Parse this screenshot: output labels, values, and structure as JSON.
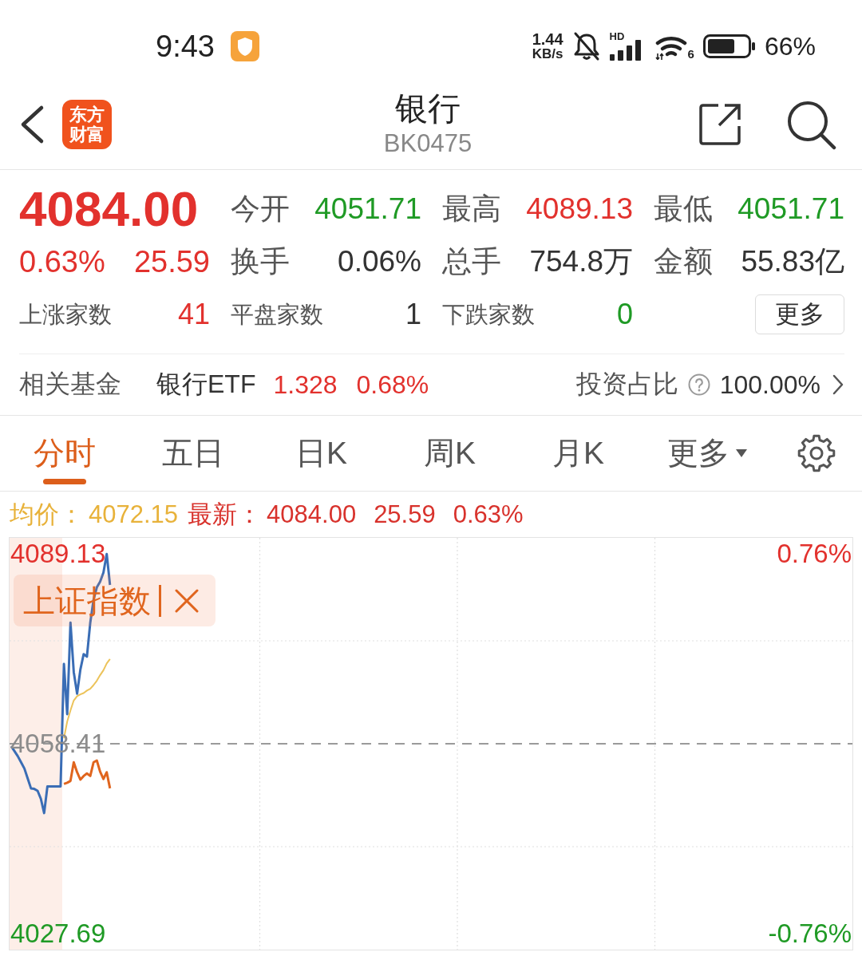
{
  "status_bar": {
    "time": "9:43",
    "net_speed": {
      "value": "1.44",
      "unit": "KB/s"
    },
    "signal_label": "HD",
    "wifi_label": "6",
    "battery": "66%"
  },
  "header": {
    "logo": [
      "东方",
      "财富"
    ],
    "title": "银行",
    "code": "BK0475"
  },
  "quote": {
    "price": {
      "text": "4084.00",
      "color": "#e2312d"
    },
    "change_pct": {
      "text": "0.63%",
      "color": "#e2312d"
    },
    "change": {
      "text": "25.59",
      "color": "#e2312d"
    },
    "stats": [
      {
        "label": "今开",
        "value": "4051.71",
        "color": "#1f9a25"
      },
      {
        "label": "最高",
        "value": "4089.13",
        "color": "#e2312d"
      },
      {
        "label": "最低",
        "value": "4051.71",
        "color": "#1f9a25"
      },
      {
        "label": "换手",
        "value": "0.06%",
        "color": "#333333"
      },
      {
        "label": "总手",
        "value": "754.8万",
        "color": "#333333"
      },
      {
        "label": "金额",
        "value": "55.83亿",
        "color": "#333333"
      }
    ],
    "breadth": [
      {
        "label": "上涨家数",
        "value": "41",
        "color": "#e2312d"
      },
      {
        "label": "平盘家数",
        "value": "1",
        "color": "#333333"
      },
      {
        "label": "下跌家数",
        "value": "0",
        "color": "#1f9a25"
      }
    ],
    "more_button": "更多"
  },
  "related_fund": {
    "label": "相关基金",
    "name": "银行ETF",
    "price": "1.328",
    "change_pct": "0.68%",
    "color": "#e2312d",
    "weight_label": "投资占比",
    "weight": "100.00%"
  },
  "tabs": [
    {
      "label": "分时",
      "selected": true,
      "kind": "tab"
    },
    {
      "label": "五日",
      "selected": false,
      "kind": "tab"
    },
    {
      "label": "日K",
      "selected": false,
      "kind": "tab"
    },
    {
      "label": "周K",
      "selected": false,
      "kind": "tab"
    },
    {
      "label": "月K",
      "selected": false,
      "kind": "tab"
    },
    {
      "label": "更多",
      "selected": false,
      "kind": "menu"
    }
  ],
  "legend": [
    {
      "label": "均价：",
      "values": [
        "4072.15"
      ],
      "color": "#e8b23a"
    },
    {
      "label": "最新：",
      "values": [
        "4084.00",
        "25.59",
        "0.63%"
      ],
      "color": "#d8322c"
    }
  ],
  "chart": {
    "right_labels": [
      {
        "text": "0.76%",
        "color": "#e2312d"
      },
      {
        "text": "-0.76%",
        "color": "#1f9a25"
      }
    ],
    "chart_data": {
      "type": "line",
      "categories": [
        null,
        null,
        null,
        null,
        null,
        null,
        null,
        null,
        null,
        null,
        null,
        null,
        null,
        null,
        null,
        null,
        null,
        null,
        null,
        null,
        null,
        null,
        null,
        null,
        null,
        null,
        null,
        null,
        null,
        null,
        null,
        null,
        null,
        null,
        null,
        null,
        null,
        null,
        null,
        null,
        null,
        null,
        null,
        null,
        null,
        null,
        null,
        null,
        null,
        null,
        null,
        null,
        null,
        null,
        null,
        null,
        null,
        null,
        null,
        null,
        null,
        null,
        null,
        null,
        null,
        null,
        null,
        null,
        null,
        null,
        null,
        null,
        null,
        null,
        null,
        null,
        null,
        null,
        null,
        null,
        null,
        null,
        null,
        null,
        null,
        null,
        null,
        null,
        null,
        null,
        null,
        null,
        null,
        null,
        null,
        null,
        null,
        null,
        null,
        null,
        null,
        null,
        null,
        null,
        null,
        null,
        null,
        null,
        null,
        null,
        null,
        null,
        null,
        null,
        null,
        null,
        null,
        null,
        null,
        null,
        null,
        null,
        null,
        null,
        null,
        null,
        null,
        null,
        null,
        null,
        null,
        null,
        null,
        null,
        null,
        null,
        null,
        null,
        null,
        null,
        null,
        null,
        null,
        null,
        null,
        null,
        null,
        null,
        null,
        null,
        null,
        null,
        null,
        null,
        null,
        null,
        null,
        null,
        null,
        null,
        null,
        null,
        null,
        null,
        null,
        null,
        null,
        null,
        null,
        null,
        null,
        null,
        null,
        null,
        null,
        null,
        null,
        null,
        null,
        null,
        null,
        null,
        null,
        null,
        null,
        null,
        null,
        null,
        null,
        null,
        null,
        null,
        null,
        null,
        null,
        null,
        null,
        null,
        null,
        null,
        null,
        null,
        null,
        null,
        null,
        null,
        null,
        null,
        null,
        null,
        null,
        null,
        null,
        null,
        null,
        null,
        null,
        null,
        null,
        null,
        null,
        null,
        null,
        null,
        null,
        null,
        null,
        null,
        null,
        null,
        null,
        null,
        null,
        null,
        null,
        null,
        null,
        null,
        null,
        null,
        null,
        null,
        null,
        null,
        null,
        null,
        null,
        null,
        null,
        null,
        null,
        null,
        null,
        null,
        null,
        null
      ],
      "ylim": [
        4025.11,
        4091.71
      ],
      "yticks": [
        {
          "value": 4089.13,
          "label": "4089.13"
        },
        {
          "value": 4027.69,
          "label": "4027.69"
        }
      ],
      "ref_lines": [
        {
          "axis": "y",
          "value": 4058.41,
          "label": "4058.41"
        }
      ],
      "series": [
        {
          "color": "#3a6db5",
          "values": [
            4058.0,
            4057.2,
            4056.4,
            4055.4,
            4054.4,
            4052.8,
            4051.2,
            4051.1,
            4050.8,
            4049.5,
            4047.2,
            4051.5,
            4051.5,
            4051.5,
            4051.5,
            4051.5,
            4071.3,
            4063.2,
            4078.0,
            4070.0,
            4066.5,
            4070.4,
            4072.9,
            4072.5,
            4078.0,
            4081.7,
            4083.7,
            4084.6,
            4086.1,
            4089.1,
            4084.1,
            null,
            null,
            null,
            null,
            null,
            null,
            null,
            null,
            null,
            null,
            null,
            null,
            null,
            null,
            null,
            null,
            null,
            null,
            null,
            null,
            null,
            null,
            null,
            null,
            null,
            null,
            null,
            null,
            null,
            null,
            null,
            null,
            null,
            null,
            null,
            null,
            null,
            null,
            null,
            null,
            null,
            null,
            null,
            null,
            null,
            null,
            null,
            null,
            null,
            null,
            null,
            null,
            null,
            null,
            null,
            null,
            null,
            null,
            null,
            null,
            null,
            null,
            null,
            null,
            null,
            null,
            null,
            null,
            null,
            null,
            null,
            null,
            null,
            null,
            null,
            null,
            null,
            null,
            null,
            null,
            null,
            null,
            null,
            null,
            null,
            null,
            null,
            null,
            null,
            null,
            null,
            null,
            null,
            null,
            null,
            null,
            null,
            null,
            null,
            null,
            null,
            null,
            null,
            null,
            null,
            null,
            null,
            null,
            null,
            null,
            null,
            null,
            null,
            null,
            null,
            null,
            null,
            null,
            null,
            null,
            null,
            null,
            null,
            null,
            null,
            null,
            null,
            null,
            null,
            null,
            null,
            null,
            null,
            null,
            null,
            null,
            null,
            null,
            null,
            null,
            null,
            null,
            null,
            null,
            null,
            null,
            null,
            null,
            null,
            null,
            null,
            null,
            null,
            null,
            null,
            null,
            null,
            null,
            null,
            null,
            null,
            null,
            null,
            null,
            null,
            null,
            null,
            null,
            null,
            null,
            null,
            null,
            null,
            null,
            null,
            null,
            null,
            null,
            null,
            null,
            null,
            null,
            null,
            null,
            null,
            null,
            null,
            null,
            null,
            null,
            null,
            null,
            null,
            null,
            null,
            null,
            null,
            null,
            null,
            null,
            null,
            null,
            null,
            null,
            null,
            null,
            null,
            null,
            null,
            null,
            null,
            null,
            null,
            null,
            null,
            null,
            null,
            null,
            null,
            null,
            null,
            null,
            null,
            null,
            null
          ]
        },
        {
          "color": "#ecc35a",
          "values": [
            null,
            null,
            null,
            null,
            null,
            null,
            null,
            null,
            null,
            null,
            null,
            null,
            null,
            null,
            null,
            null,
            4059.3,
            4062.0,
            4063.8,
            4065.4,
            4066.1,
            4066.4,
            4066.6,
            4067.0,
            4067.3,
            4067.9,
            4068.6,
            4069.5,
            4070.3,
            4071.4,
            4072.1,
            null,
            null,
            null,
            null,
            null,
            null,
            null,
            null,
            null,
            null,
            null,
            null,
            null,
            null,
            null,
            null,
            null,
            null,
            null,
            null,
            null,
            null,
            null,
            null,
            null,
            null,
            null,
            null,
            null,
            null,
            null,
            null,
            null,
            null,
            null,
            null,
            null,
            null,
            null,
            null,
            null,
            null,
            null,
            null,
            null,
            null,
            null,
            null,
            null,
            null,
            null,
            null,
            null,
            null,
            null,
            null,
            null,
            null,
            null,
            null,
            null,
            null,
            null,
            null,
            null,
            null,
            null,
            null,
            null,
            null,
            null,
            null,
            null,
            null,
            null,
            null,
            null,
            null,
            null,
            null,
            null,
            null,
            null,
            null,
            null,
            null,
            null,
            null,
            null,
            null,
            null,
            null,
            null,
            null,
            null,
            null,
            null,
            null,
            null,
            null,
            null,
            null,
            null,
            null,
            null,
            null,
            null,
            null,
            null,
            null,
            null,
            null,
            null,
            null,
            null,
            null,
            null,
            null,
            null,
            null,
            null,
            null,
            null,
            null,
            null,
            null,
            null,
            null,
            null,
            null,
            null,
            null,
            null,
            null,
            null,
            null,
            null,
            null,
            null,
            null,
            null,
            null,
            null,
            null,
            null,
            null,
            null,
            null,
            null,
            null,
            null,
            null,
            null,
            null,
            null,
            null,
            null,
            null,
            null,
            null,
            null,
            null,
            null,
            null,
            null,
            null,
            null,
            null,
            null,
            null,
            null,
            null,
            null,
            null,
            null,
            null,
            null,
            null,
            null,
            null,
            null,
            null,
            null,
            null,
            null,
            null,
            null,
            null,
            null,
            null,
            null,
            null,
            null,
            null,
            null,
            null,
            null,
            null,
            null,
            null,
            null,
            null,
            null,
            null,
            null,
            null,
            null,
            null,
            null,
            null,
            null,
            null,
            null,
            null,
            null,
            null,
            null,
            null,
            null,
            null,
            null,
            null,
            null,
            null,
            null
          ]
        },
        {
          "name": "上证指数",
          "color": "#e0651e",
          "values": [
            null,
            null,
            null,
            null,
            null,
            null,
            null,
            null,
            null,
            null,
            null,
            null,
            null,
            null,
            null,
            null,
            4051.9,
            4052.1,
            4052.4,
            4055.4,
            4053.8,
            4052.6,
            4053.2,
            4053.6,
            4053.2,
            4055.4,
            4055.7,
            4053.9,
            4052.7,
            4053.8,
            4051.2,
            null,
            null,
            null,
            null,
            null,
            null,
            null,
            null,
            null,
            null,
            null,
            null,
            null,
            null,
            null,
            null,
            null,
            null,
            null,
            null,
            null,
            null,
            null,
            null,
            null,
            null,
            null,
            null,
            null,
            null,
            null,
            null,
            null,
            null,
            null,
            null,
            null,
            null,
            null,
            null,
            null,
            null,
            null,
            null,
            null,
            null,
            null,
            null,
            null,
            null,
            null,
            null,
            null,
            null,
            null,
            null,
            null,
            null,
            null,
            null,
            null,
            null,
            null,
            null,
            null,
            null,
            null,
            null,
            null,
            null,
            null,
            null,
            null,
            null,
            null,
            null,
            null,
            null,
            null,
            null,
            null,
            null,
            null,
            null,
            null,
            null,
            null,
            null,
            null,
            null,
            null,
            null,
            null,
            null,
            null,
            null,
            null,
            null,
            null,
            null,
            null,
            null,
            null,
            null,
            null,
            null,
            null,
            null,
            null,
            null,
            null,
            null,
            null,
            null,
            null,
            null,
            null,
            null,
            null,
            null,
            null,
            null,
            null,
            null,
            null,
            null,
            null,
            null,
            null,
            null,
            null,
            null,
            null,
            null,
            null,
            null,
            null,
            null,
            null,
            null,
            null,
            null,
            null,
            null,
            null,
            null,
            null,
            null,
            null,
            null,
            null,
            null,
            null,
            null,
            null,
            null,
            null,
            null,
            null,
            null,
            null,
            null,
            null,
            null,
            null,
            null,
            null,
            null,
            null,
            null,
            null,
            null,
            null,
            null,
            null,
            null,
            null,
            null,
            null,
            null,
            null,
            null,
            null,
            null,
            null,
            null,
            null,
            null,
            null,
            null,
            null,
            null,
            null,
            null,
            null,
            null,
            null,
            null,
            null,
            null,
            null,
            null,
            null,
            null,
            null,
            null,
            null,
            null,
            null,
            null,
            null,
            null,
            null,
            null,
            null,
            null,
            null,
            null,
            null,
            null,
            null,
            null,
            null,
            null,
            null
          ]
        }
      ]
    }
  }
}
